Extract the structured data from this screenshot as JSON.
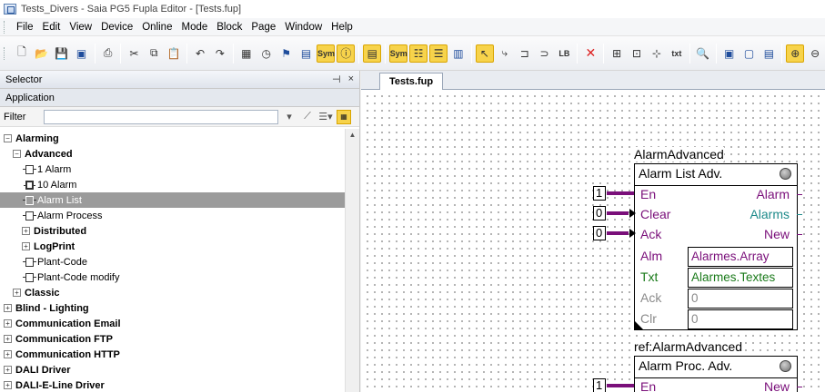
{
  "window": {
    "title": "Tests_Divers - Saia PG5 Fupla Editor - [Tests.fup]"
  },
  "menu": [
    "File",
    "Edit",
    "View",
    "Device",
    "Online",
    "Mode",
    "Block",
    "Page",
    "Window",
    "Help"
  ],
  "toolbar": {
    "icons": [
      "new-icon",
      "open-icon",
      "save-icon",
      "save-all-icon",
      "print-icon",
      "cut-icon",
      "copy-icon",
      "paste-icon",
      "undo-icon",
      "redo-icon",
      "calendar-icon",
      "clock-icon",
      "mark-icon",
      "monitor-icon",
      "symbol-icon",
      "info-icon",
      "properties-icon",
      "sym-editor-icon",
      "library-icon",
      "list-icon",
      "layout-icon",
      "pointer-icon",
      "connect-icon",
      "line-icon",
      "lb-icon",
      "delete-icon",
      "insert-icon",
      "zoom-icon",
      "page-icon"
    ],
    "sym_label": "Sym",
    "lb_label": "LB",
    "txt_label": "txt"
  },
  "selector": {
    "title": "Selector",
    "pin": "ᵖ",
    "close": "×",
    "tab": "Application",
    "filter_label": "Filter",
    "filter_value": "",
    "tree": [
      {
        "level": 0,
        "label": "Alarming",
        "expander": "−",
        "bold": true
      },
      {
        "level": 1,
        "label": "Advanced",
        "expander": "−",
        "bold": true
      },
      {
        "level": 2,
        "label": "1 Alarm",
        "icon": "fbox-icon"
      },
      {
        "level": 2,
        "label": "10 Alarm",
        "icon": "multi-fbox-icon"
      },
      {
        "level": 2,
        "label": "Alarm List",
        "icon": "fbox-icon",
        "selected": true
      },
      {
        "level": 2,
        "label": "Alarm Process",
        "icon": "fbox-icon"
      },
      {
        "level": 2,
        "label": "Distributed",
        "expander": "+",
        "bold": true
      },
      {
        "level": 2,
        "label": "LogPrint",
        "expander": "+",
        "bold": true
      },
      {
        "level": 2,
        "label": "Plant-Code",
        "icon": "fbox-icon"
      },
      {
        "level": 2,
        "label": "Plant-Code modify",
        "icon": "fbox-icon"
      },
      {
        "level": 1,
        "label": "Classic",
        "expander": "+",
        "bold": true
      },
      {
        "level": 0,
        "label": "Blind - Lighting",
        "expander": "+",
        "bold": true
      },
      {
        "level": 0,
        "label": "Communication Email",
        "expander": "+",
        "bold": true
      },
      {
        "level": 0,
        "label": "Communication FTP",
        "expander": "+",
        "bold": true
      },
      {
        "level": 0,
        "label": "Communication HTTP",
        "expander": "+",
        "bold": true
      },
      {
        "level": 0,
        "label": "DALI Driver",
        "expander": "+",
        "bold": true
      },
      {
        "level": 0,
        "label": "DALI-E-Line Driver",
        "expander": "+",
        "bold": true
      }
    ]
  },
  "editor": {
    "tab": "Tests.fup",
    "block1": {
      "name": "AlarmAdvanced",
      "title": "Alarm List Adv.",
      "inputs": [
        {
          "const": "1",
          "label": "En",
          "arrow": false
        },
        {
          "const": "0",
          "label": "Clear",
          "arrow": true
        },
        {
          "const": "0",
          "label": "Ack",
          "arrow": true
        }
      ],
      "outputs": [
        "Alarm",
        "Alarms",
        "New"
      ],
      "params": [
        {
          "label": "Alm",
          "value": "Alarmes.Array"
        },
        {
          "label": "Txt",
          "value": "Alarmes.Textes"
        },
        {
          "label": "Ack",
          "value": "0"
        },
        {
          "label": "Clr",
          "value": "0"
        }
      ]
    },
    "block2": {
      "name": "ref:AlarmAdvanced",
      "title": "Alarm Proc. Adv.",
      "inputs": [
        {
          "const": "1",
          "label": "En"
        }
      ],
      "outputs": [
        "New"
      ]
    }
  },
  "colors": {
    "wire": "#7a0f7a",
    "selection": "#9b9b9b",
    "highlight": "#f7d34b"
  }
}
